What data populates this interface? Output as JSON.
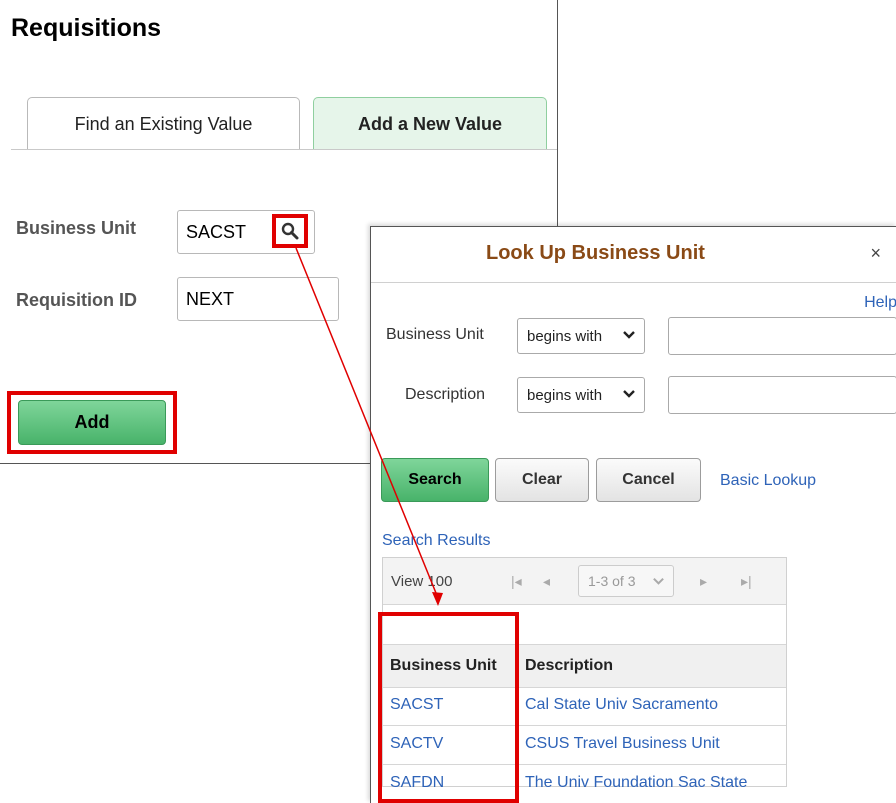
{
  "page": {
    "title": "Requisitions",
    "tabs": [
      {
        "label": "Find an Existing Value"
      },
      {
        "label": "Add a New Value"
      }
    ],
    "business_unit_label": "Business Unit",
    "business_unit_value": "SACST",
    "requisition_id_label": "Requisition ID",
    "requisition_id_value": "NEXT",
    "add_label": "Add"
  },
  "lookup": {
    "title": "Look Up Business Unit",
    "close": "×",
    "help": "Help",
    "criteria": [
      {
        "label": "Business Unit",
        "operator": "begins with",
        "value": ""
      },
      {
        "label": "Description",
        "operator": "begins with",
        "value": ""
      }
    ],
    "search_label": "Search",
    "clear_label": "Clear",
    "cancel_label": "Cancel",
    "basic_lookup_label": "Basic Lookup",
    "results_title": "Search Results",
    "view_label": "View 100",
    "range_label": "1-3 of 3",
    "columns": [
      "Business Unit",
      "Description"
    ],
    "rows": [
      {
        "unit": "SACST",
        "description": "Cal State Univ Sacramento"
      },
      {
        "unit": "SACTV",
        "description": "CSUS Travel Business Unit"
      },
      {
        "unit": "SAFDN",
        "description": "The Univ Foundation Sac State"
      }
    ]
  },
  "colors": {
    "highlight": "#e00000",
    "link": "#2e63b8",
    "primary_button": "#48b36a",
    "dialog_title": "#8a4a16"
  }
}
